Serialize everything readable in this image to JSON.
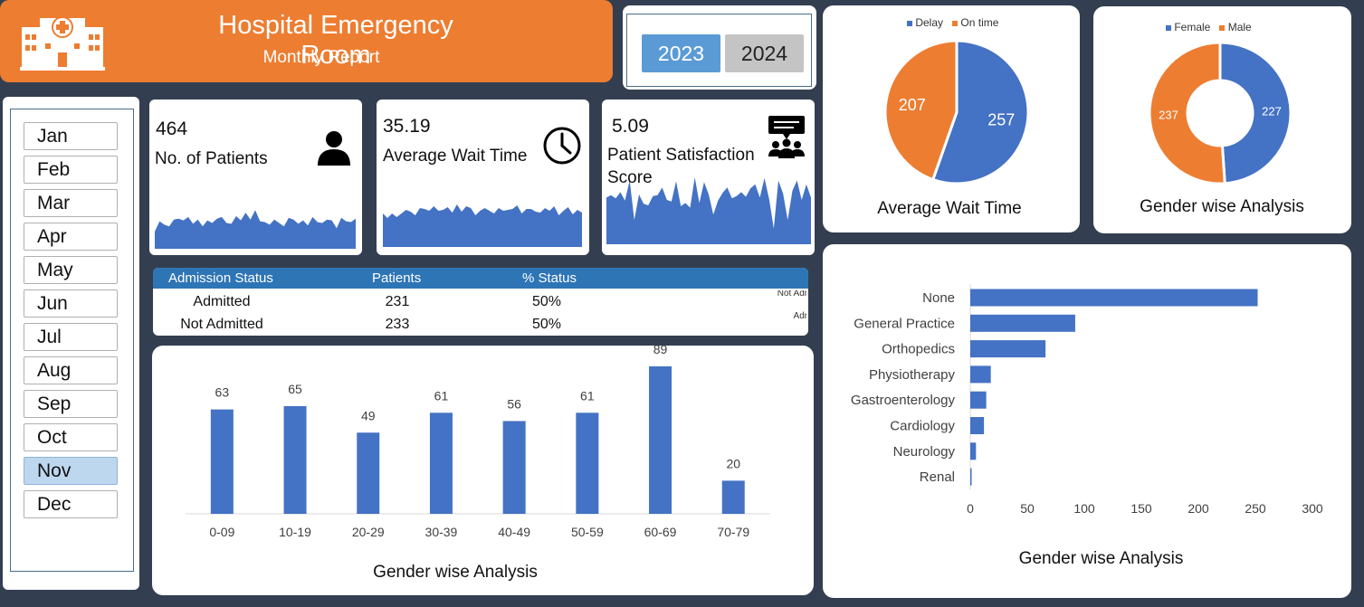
{
  "header": {
    "title": "Hospital Emergency Room",
    "subtitle": "Monthly Report"
  },
  "years": [
    {
      "label": "2023",
      "selected": true
    },
    {
      "label": "2024",
      "selected": false
    }
  ],
  "months": [
    {
      "label": "Jan",
      "selected": false
    },
    {
      "label": "Feb",
      "selected": false
    },
    {
      "label": "Mar",
      "selected": false
    },
    {
      "label": "Apr",
      "selected": false
    },
    {
      "label": "May",
      "selected": false
    },
    {
      "label": "Jun",
      "selected": false
    },
    {
      "label": "Jul",
      "selected": false
    },
    {
      "label": "Aug",
      "selected": false
    },
    {
      "label": "Sep",
      "selected": false
    },
    {
      "label": "Oct",
      "selected": false
    },
    {
      "label": "Nov",
      "selected": true
    },
    {
      "label": "Dec",
      "selected": false
    }
  ],
  "kpis": {
    "patients": {
      "value": "464",
      "label": "No. of Patients"
    },
    "wait_time": {
      "value": "35.19",
      "label": "Average Wait Time"
    },
    "satisfaction": {
      "value": "5.09",
      "label": "Patient Satisfaction Score"
    }
  },
  "admission": {
    "headers": [
      "Admission Status",
      "Patients",
      "% Status"
    ],
    "rows": [
      {
        "status": "Admitted",
        "patients": "231",
        "pct": "50%"
      },
      {
        "status": "Not Admitted",
        "patients": "233",
        "pct": "50%"
      }
    ]
  },
  "colors": {
    "blue": "#4472c4",
    "orange": "#ed7d31",
    "header_blue": "#2e75b6",
    "background": "#333f50"
  },
  "chart_data": [
    {
      "id": "patients-sparkline",
      "type": "area",
      "values": [
        20,
        32,
        28,
        26,
        34,
        35,
        33,
        37,
        29,
        34,
        26,
        33,
        30,
        35,
        37,
        30,
        29,
        38,
        33,
        42,
        34,
        45,
        32,
        31,
        28,
        34,
        30,
        26,
        36,
        34,
        29,
        33,
        27,
        37,
        31,
        30,
        34,
        33,
        24,
        36,
        32,
        31,
        35
      ]
    },
    {
      "id": "wait-time-sparkline",
      "type": "area",
      "values": [
        37,
        32,
        37,
        33,
        37,
        41,
        39,
        35,
        43,
        42,
        40,
        45,
        40,
        41,
        44,
        38,
        47,
        39,
        45,
        43,
        35,
        40,
        43,
        40,
        37,
        43,
        40,
        41,
        42,
        46,
        37,
        42,
        42,
        39,
        38,
        43,
        40,
        45,
        35,
        40,
        44,
        36,
        41,
        38
      ]
    },
    {
      "id": "satisfaction-sparkline",
      "type": "area",
      "values": [
        60,
        63,
        59,
        67,
        56,
        82,
        31,
        64,
        52,
        50,
        62,
        63,
        73,
        57,
        55,
        81,
        49,
        53,
        47,
        86,
        53,
        80,
        64,
        38,
        56,
        66,
        73,
        59,
        62,
        67,
        61,
        72,
        77,
        60,
        85,
        58,
        20,
        82,
        65,
        31,
        69,
        82,
        57,
        77,
        60
      ]
    },
    {
      "id": "wait-time-pie",
      "type": "pie",
      "title": "Average Wait Time",
      "legend": [
        "Delay",
        "On time"
      ],
      "values": [
        257,
        207
      ],
      "colors": [
        "#4472c4",
        "#ed7d31"
      ]
    },
    {
      "id": "gender-donut",
      "type": "pie",
      "title": "Gender wise Analysis",
      "legend": [
        "Female",
        "Male"
      ],
      "values": [
        227,
        237
      ],
      "colors": [
        "#4472c4",
        "#ed7d31"
      ]
    },
    {
      "id": "age-bar",
      "type": "bar",
      "title": "Gender wise Analysis",
      "categories": [
        "0-09",
        "10-19",
        "20-29",
        "30-39",
        "40-49",
        "50-59",
        "60-69",
        "70-79"
      ],
      "values": [
        63,
        65,
        49,
        61,
        56,
        61,
        89,
        20
      ],
      "ylim": [
        0,
        100
      ]
    },
    {
      "id": "department-bar",
      "type": "bar",
      "orientation": "horizontal",
      "title": "Gender wise Analysis",
      "categories": [
        "None",
        "General Practice",
        "Orthopedics",
        "Physiotherapy",
        "Gastroenterology",
        "Cardiology",
        "Neurology",
        "Renal"
      ],
      "values": [
        252,
        92,
        66,
        18,
        14,
        12,
        5,
        1
      ],
      "xticks": [
        "0",
        "50",
        "100",
        "150",
        "200",
        "250",
        "300"
      ],
      "xlim": [
        0,
        300
      ]
    },
    {
      "id": "admission-mini-bar",
      "type": "bar",
      "orientation": "horizontal",
      "categories": [
        "Not Admitted",
        "Admitted"
      ],
      "values": [
        50.22,
        49.78
      ],
      "value_labels": [
        "50.22%",
        "49.78%"
      ]
    }
  ]
}
